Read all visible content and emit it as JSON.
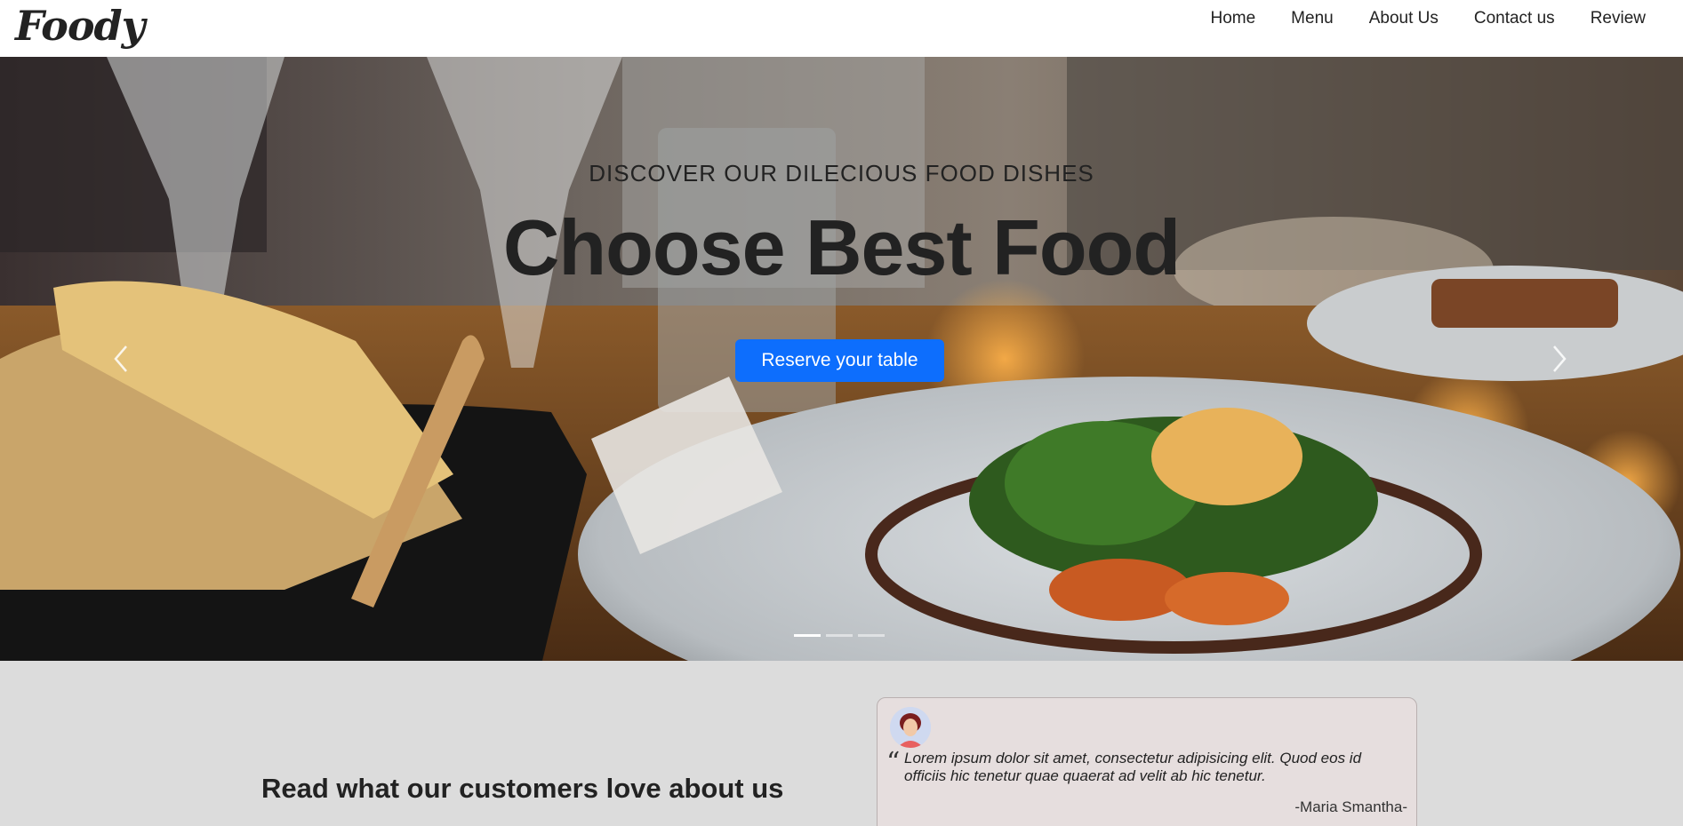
{
  "brand": {
    "logo": "Foody"
  },
  "nav": {
    "items": [
      {
        "label": "Home"
      },
      {
        "label": "Menu"
      },
      {
        "label": "About Us"
      },
      {
        "label": "Contact us"
      },
      {
        "label": "Review"
      }
    ]
  },
  "hero": {
    "subtitle": "DISCOVER OUR DILECIOUS FOOD DISHES",
    "title": "Choose Best Food",
    "cta_label": "Reserve your table",
    "slide_count": 3,
    "active_slide": 1,
    "prev_icon": "chevron-left-icon",
    "next_icon": "chevron-right-icon"
  },
  "reviews": {
    "heading": "Read what our customers love about us",
    "card": {
      "text": "Lorem ipsum dolor sit amet, consectetur adipisicing elit. Quod eos id officiis hic tenetur quae quaerat ad velit ab hic tenetur.",
      "author": "-Maria Smantha-",
      "quote_icon": "quote-left-icon"
    }
  },
  "colors": {
    "primary": "#0d6efd",
    "review_bg": "#dcdcdc",
    "card_bg": "#e6dede"
  }
}
